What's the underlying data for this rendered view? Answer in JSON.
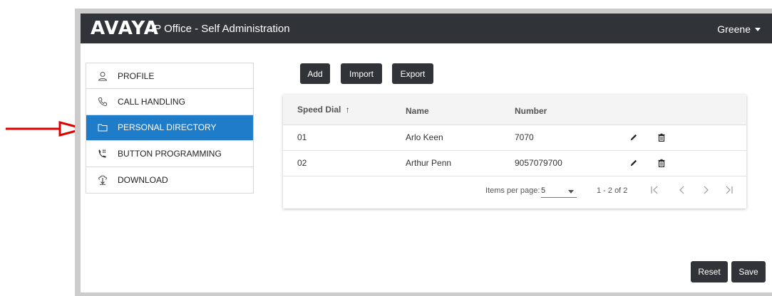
{
  "header": {
    "logo": "AVAYA",
    "title": "IP Office - Self Administration",
    "user": "Greene"
  },
  "sidebar": {
    "items": [
      {
        "label": "PROFILE",
        "icon": "person-icon",
        "active": false
      },
      {
        "label": "CALL HANDLING",
        "icon": "phone-icon",
        "active": false
      },
      {
        "label": "PERSONAL DIRECTORY",
        "icon": "folder-icon",
        "active": true
      },
      {
        "label": "BUTTON PROGRAMMING",
        "icon": "phone-keypad-icon",
        "active": false
      },
      {
        "label": "DOWNLOAD",
        "icon": "download-icon",
        "active": false
      }
    ]
  },
  "toolbar": {
    "add": "Add",
    "import": "Import",
    "export": "Export"
  },
  "table": {
    "columns": [
      "Speed Dial",
      "Name",
      "Number"
    ],
    "sort_indicator": "↑",
    "rows": [
      {
        "speed_dial": "01",
        "name": "Arlo Keen",
        "number": "7070"
      },
      {
        "speed_dial": "02",
        "name": "Arthur Penn",
        "number": "9057079700"
      }
    ]
  },
  "pagination": {
    "items_per_page_label": "Items per page:",
    "items_per_page": "5",
    "range": "1 - 2 of 2"
  },
  "footer": {
    "reset": "Reset",
    "save": "Save"
  },
  "colors": {
    "topbar": "#303338",
    "active_nav": "#1e7cc8",
    "annotation_arrow": "#e00000"
  }
}
